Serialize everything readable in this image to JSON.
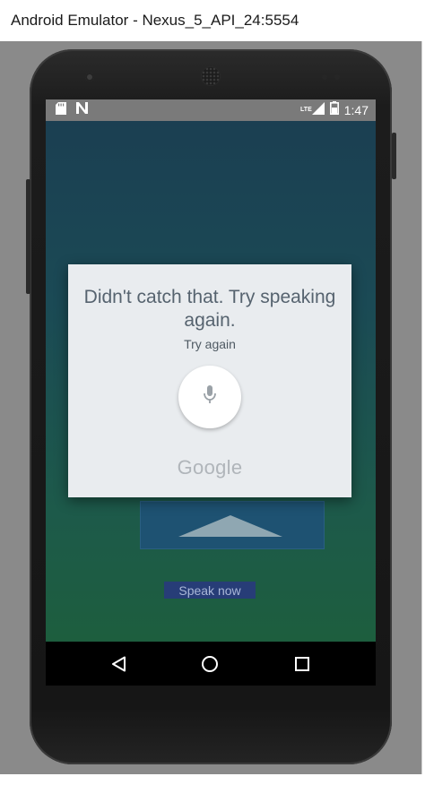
{
  "window": {
    "title": "Android Emulator - Nexus_5_API_24:5554"
  },
  "status_bar": {
    "left_icons": [
      "sd-card-icon",
      "n-notification-icon"
    ],
    "network": "LTE",
    "right_icons": [
      "signal-icon",
      "battery-icon"
    ],
    "time": "1:47"
  },
  "app": {
    "speak_button_label": "Speak now"
  },
  "dialog": {
    "message": "Didn't catch that. Try speaking again.",
    "retry_label": "Try again",
    "mic_icon": "microphone-icon",
    "brand": "Google"
  },
  "nav_bar": {
    "buttons": [
      "back-icon",
      "home-icon",
      "recents-icon"
    ]
  },
  "colors": {
    "status_bar": "#7a7a7a",
    "dialog_bg": "#e9ecef",
    "speak_button": "#273d77",
    "screen_gradient_top": "#1b3f52",
    "screen_gradient_bottom": "#1d5e3e"
  }
}
